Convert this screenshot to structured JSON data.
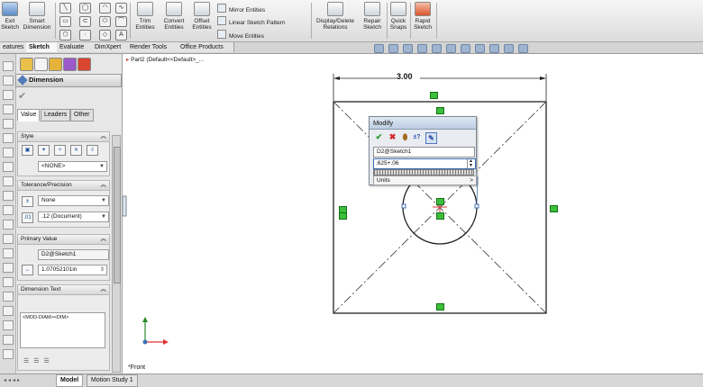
{
  "ribbon": {
    "exit_sketch": [
      "Exit",
      "Sketch"
    ],
    "smart_dimension": [
      "Smart",
      "Dimension"
    ],
    "trim_entities": [
      "Trim",
      "Entities"
    ],
    "convert_entities": [
      "Convert",
      "Entities"
    ],
    "offset_entities": [
      "Offset",
      "Entities"
    ],
    "mirror_entities": "Mirror Entities",
    "linear_sketch_pattern": "Linear Sketch Pattern",
    "move_entities": "Move Entities",
    "display_delete_relations": [
      "Display/Delete",
      "Relations"
    ],
    "repair_sketch": [
      "Repair",
      "Sketch"
    ],
    "quick_snaps": [
      "Quick",
      "Snaps"
    ],
    "rapid_sketch": [
      "Rapid",
      "Sketch"
    ]
  },
  "tabs": [
    "eatures",
    "Sketch",
    "Evaluate",
    "DimXpert",
    "Render Tools",
    "Office Products"
  ],
  "active_tab": "Sketch",
  "tree": {
    "part_label": "Part2  (Default<<Default>_..."
  },
  "property_manager": {
    "title": "Dimension",
    "subtabs": [
      "Value",
      "Leaders",
      "Other"
    ],
    "style": {
      "heading": "Style",
      "selected": "<NONE>"
    },
    "tolerance": {
      "heading": "Tolerance/Precision",
      "tolerance_type": "None",
      "precision": ".12 (Document)"
    },
    "primary_value": {
      "heading": "Primary Value",
      "name": "D2@Sketch1",
      "value": "1.07052101in"
    },
    "dimension_text": {
      "heading": "Dimension Text",
      "text": "<MOD-DIAM><DIM>"
    }
  },
  "modify_dialog": {
    "title": "Modify",
    "dimension_name": "D2@Sketch1",
    "value": ".625+.06",
    "units_label": "Units"
  },
  "drawing": {
    "width_dimension": "3.00"
  },
  "view_label": "*Front",
  "bottom_tabs": [
    "Model",
    "Motion Study 1"
  ],
  "colors": {
    "relation_marker": "#3cbf3c",
    "selected_blue": "#3d6fb2",
    "ribbon_bg": "#dcdcdc"
  }
}
